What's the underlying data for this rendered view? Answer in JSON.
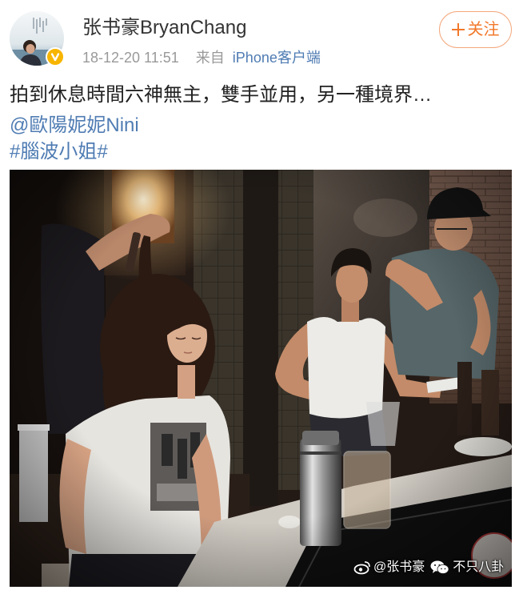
{
  "post": {
    "author": {
      "name": "张书豪BryanChang",
      "verified": true
    },
    "meta": {
      "time": "18-12-20 11:51",
      "source_prefix": "来自",
      "source": "iPhone客户端"
    },
    "follow_button": {
      "label": "关注",
      "icon": "plus-icon"
    },
    "content": {
      "text": "拍到休息時間六神無主，雙手並用，另一種境界…",
      "mention": "@歐陽妮妮Nini",
      "hashtag": "#腦波小姐#"
    },
    "photo": {
      "watermark_weibo": "@张书豪",
      "watermark_wechat": "不只八卦"
    }
  },
  "icons": {
    "verified": "verified-badge-icon",
    "follow": "plus-icon",
    "weibo": "weibo-logo-icon",
    "wechat": "wechat-logo-icon"
  },
  "colors": {
    "link": "#4f7cb3",
    "follow_accent": "#f2782a",
    "verified_badge": "#f7b500",
    "meta_text": "#999999",
    "body_text": "#222222"
  }
}
